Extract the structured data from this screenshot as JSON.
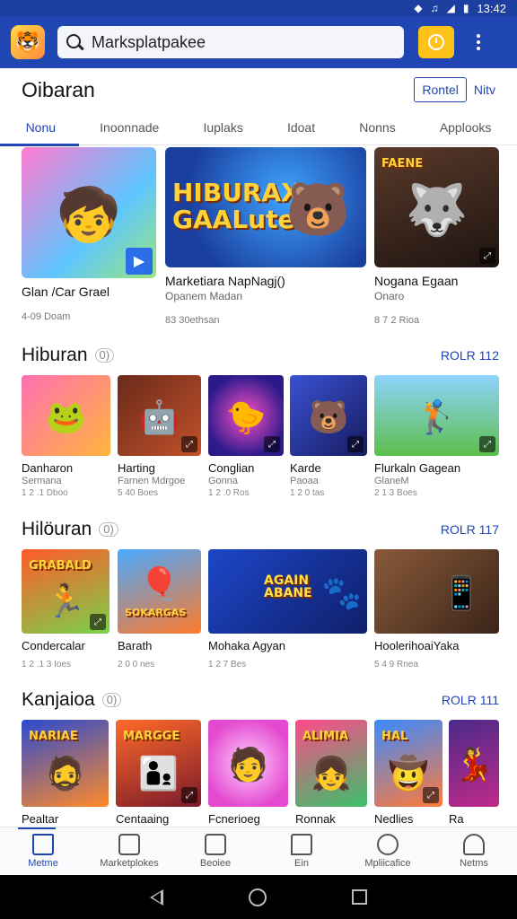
{
  "status": {
    "time": "13:42"
  },
  "search": {
    "value": "Marksplatpakee"
  },
  "header": {
    "title": "Oibaran",
    "outline_button": "Rontel",
    "text_button": "Nitv"
  },
  "tabs": [
    "Nonu",
    "Inoonnade",
    "Iuplaks",
    "Idoat",
    "Nonns",
    "Applooks"
  ],
  "featured": [
    {
      "title": "Glan /Car Grael",
      "subtitle": "",
      "meta": "4-09 Doam",
      "art_text": "",
      "emoji": "🧒"
    },
    {
      "title": "Marketiara NapNagj()",
      "subtitle": "Opanem Madan",
      "meta": "83 30ethsan",
      "art_text": "HIBURAX GAALute",
      "emoji": "🐻"
    },
    {
      "title": "Nogana Egaan",
      "subtitle": "Onaro",
      "meta": "8 7 2 Rioa",
      "art_text": "FAENE",
      "emoji": "🐺"
    }
  ],
  "sections": [
    {
      "title": "Hiburan",
      "badge": "0)",
      "more": "ROLR 112",
      "items": [
        {
          "title": "Danharon",
          "subtitle": "Sermana",
          "meta": "1 2 .1 Dboo",
          "emoji": "🐸",
          "art_text": ""
        },
        {
          "title": "Harting",
          "subtitle": "Farnen Mdrgoe",
          "meta": "5 40 Boes",
          "emoji": "🤖",
          "art_text": ""
        },
        {
          "title": "Conglian",
          "subtitle": "Gonna",
          "meta": "1 2 .0 Ros",
          "emoji": "🐤",
          "art_text": ""
        },
        {
          "title": "Karde",
          "subtitle": "Paoaa",
          "meta": "1 2 0 tas",
          "emoji": "🐻",
          "art_text": ""
        },
        {
          "title": "Flurkaln Gagean",
          "subtitle": "GlaneM",
          "meta": "2 1 3 Boes",
          "emoji": "🏌️",
          "art_text": ""
        }
      ]
    },
    {
      "title": "Hilöuran",
      "badge": "0)",
      "more": "ROLR 117",
      "items": [
        {
          "title": "Condercalar",
          "subtitle": "",
          "meta": "1 2 .1 3 Ioes",
          "emoji": "🏃",
          "art_text": "GRABALD"
        },
        {
          "title": "Barath",
          "subtitle": "",
          "meta": "2 0 0 nes",
          "emoji": "🎈",
          "art_text": "SOKARGAS"
        },
        {
          "title": "Mohaka Agyan",
          "subtitle": "",
          "meta": "1 2 7 Bes",
          "emoji": "🐾",
          "art_text": "AGAIN ABANE"
        },
        {
          "title": "HoolerihoaiYaka",
          "subtitle": "",
          "meta": "5 4 9 Rnea",
          "emoji": "📱",
          "art_text": ""
        }
      ]
    },
    {
      "title": "Kanjaioa",
      "badge": "0)",
      "more": "ROLR 111",
      "items": [
        {
          "title": "Pealtar",
          "subtitle": "",
          "meta": "",
          "emoji": "🧔",
          "art_text": "NARIAE"
        },
        {
          "title": "Centaaing",
          "subtitle": "",
          "meta": "",
          "emoji": "👨‍👦",
          "art_text": "MARGGE"
        },
        {
          "title": "Fcnerioeg",
          "subtitle": "",
          "meta": "",
          "emoji": "🧑",
          "art_text": ""
        },
        {
          "title": "Ronnak",
          "subtitle": "",
          "meta": "",
          "emoji": "👧",
          "art_text": "ALIMIA"
        },
        {
          "title": "Nedlies",
          "subtitle": "",
          "meta": "",
          "emoji": "🤠",
          "art_text": "HAL"
        },
        {
          "title": "Ra",
          "subtitle": "",
          "meta": "",
          "emoji": "💃",
          "art_text": ""
        }
      ]
    }
  ],
  "bottom_nav": [
    "Metme",
    "Marketplokes",
    "Beoiee",
    "Ein",
    "Mpliicafice",
    "Netms"
  ],
  "colors": {
    "primary": "#2046b4",
    "accent": "#ffc21a"
  }
}
